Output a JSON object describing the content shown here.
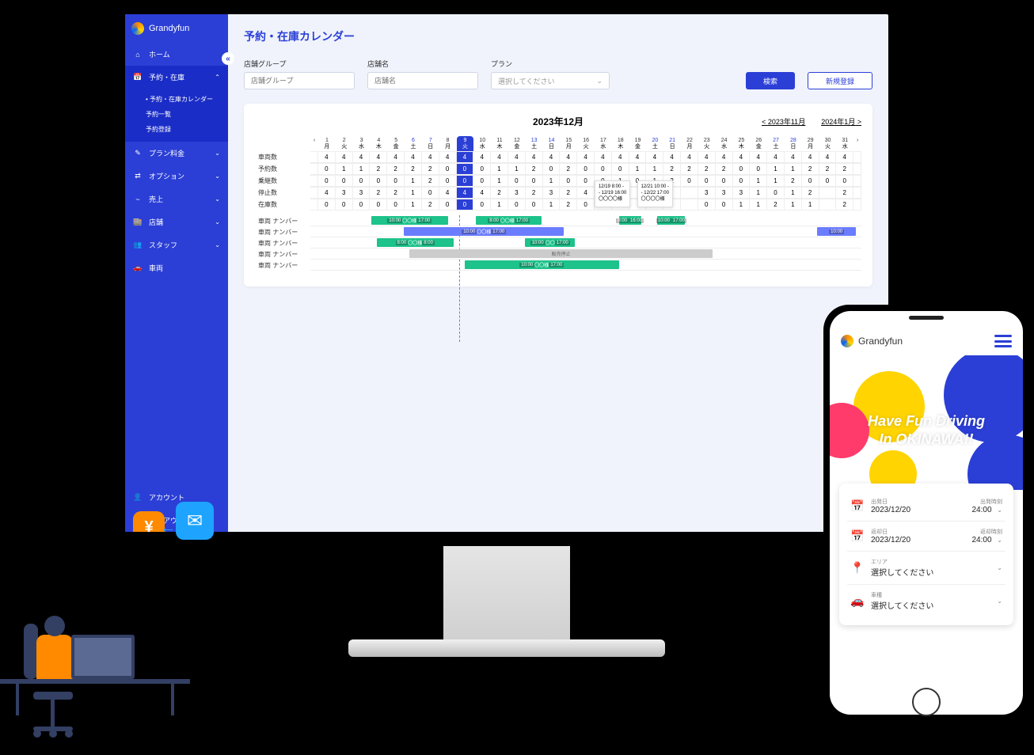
{
  "brand": "Grandyfun",
  "sidebar": {
    "items": [
      {
        "icon": "⌂",
        "label": "ホーム"
      },
      {
        "icon": "📅",
        "label": "予約・在庫",
        "chev": "⌃",
        "active": true
      },
      {
        "icon": "✎",
        "label": "プラン料金",
        "chev": "⌄"
      },
      {
        "icon": "⇄",
        "label": "オプション",
        "chev": "⌄"
      },
      {
        "icon": "~",
        "label": "売上",
        "chev": "⌄"
      },
      {
        "icon": "🏬",
        "label": "店舗",
        "chev": "⌄"
      },
      {
        "icon": "👥",
        "label": "スタッフ",
        "chev": "⌄"
      },
      {
        "icon": "🚗",
        "label": "車両"
      }
    ],
    "sub": [
      "予約・在庫カレンダー",
      "予約一覧",
      "予約登録"
    ],
    "bottom": [
      {
        "icon": "👤",
        "label": "アカウント"
      },
      {
        "icon": "↪",
        "label": "ログアウト"
      }
    ]
  },
  "page": {
    "title": "予約・在庫カレンダー",
    "filters": {
      "group_label": "店舗グループ",
      "group_ph": "店舗グループ",
      "store_label": "店舗名",
      "store_ph": "店舗名",
      "plan_label": "プラン",
      "plan_ph": "選択してください"
    },
    "search": "検索",
    "register": "新規登録"
  },
  "cal": {
    "title": "2023年12月",
    "prev": "2023年11月",
    "next": "2024年1月",
    "days": [
      {
        "n": "1",
        "w": "月"
      },
      {
        "n": "2",
        "w": "火"
      },
      {
        "n": "3",
        "w": "水"
      },
      {
        "n": "4",
        "w": "木"
      },
      {
        "n": "5",
        "w": "金"
      },
      {
        "n": "6",
        "w": "土",
        "c": "sat"
      },
      {
        "n": "7",
        "w": "日",
        "c": "sun"
      },
      {
        "n": "8",
        "w": "月"
      },
      {
        "n": "9",
        "w": "火",
        "c": "today"
      },
      {
        "n": "10",
        "w": "水"
      },
      {
        "n": "11",
        "w": "木"
      },
      {
        "n": "12",
        "w": "金"
      },
      {
        "n": "13",
        "w": "土",
        "c": "sat"
      },
      {
        "n": "14",
        "w": "日",
        "c": "sun"
      },
      {
        "n": "15",
        "w": "月"
      },
      {
        "n": "16",
        "w": "火"
      },
      {
        "n": "17",
        "w": "水"
      },
      {
        "n": "18",
        "w": "木"
      },
      {
        "n": "19",
        "w": "金"
      },
      {
        "n": "20",
        "w": "土",
        "c": "sat"
      },
      {
        "n": "21",
        "w": "日",
        "c": "sun"
      },
      {
        "n": "22",
        "w": "月"
      },
      {
        "n": "23",
        "w": "火"
      },
      {
        "n": "24",
        "w": "水"
      },
      {
        "n": "25",
        "w": "木"
      },
      {
        "n": "26",
        "w": "金"
      },
      {
        "n": "27",
        "w": "土",
        "c": "sat"
      },
      {
        "n": "28",
        "w": "日",
        "c": "sun"
      },
      {
        "n": "29",
        "w": "月"
      },
      {
        "n": "30",
        "w": "火"
      },
      {
        "n": "31",
        "w": "水"
      }
    ],
    "rows": [
      {
        "label": "車両数",
        "v": [
          "4",
          "4",
          "4",
          "4",
          "4",
          "4",
          "4",
          "4",
          "4",
          "4",
          "4",
          "4",
          "4",
          "4",
          "4",
          "4",
          "4",
          "4",
          "4",
          "4",
          "4",
          "4",
          "4",
          "4",
          "4",
          "4",
          "4",
          "4",
          "4",
          "4",
          "4"
        ]
      },
      {
        "label": "予約数",
        "v": [
          "0",
          "1",
          "1",
          "2",
          "2",
          "2",
          "2",
          "0",
          "0",
          "0",
          "1",
          "1",
          "2",
          "0",
          "2",
          "0",
          "0",
          "0",
          "1",
          "1",
          "2",
          "2",
          "2",
          "2",
          "0",
          "0",
          "1",
          "1",
          "2",
          "2",
          "2"
        ]
      },
      {
        "label": "乗継数",
        "v": [
          "0",
          "0",
          "0",
          "0",
          "0",
          "1",
          "2",
          "0",
          "0",
          "0",
          "1",
          "0",
          "0",
          "1",
          "0",
          "0",
          "0",
          "1",
          "0",
          "1",
          "2",
          "0",
          "0",
          "0",
          "0",
          "1",
          "1",
          "2",
          "0",
          "0",
          "0"
        ]
      },
      {
        "label": "停止数",
        "v": [
          "4",
          "3",
          "3",
          "2",
          "2",
          "1",
          "0",
          "4",
          "4",
          "4",
          "2",
          "3",
          "2",
          "3",
          "2",
          "4",
          "4",
          "3",
          "",
          "",
          "",
          "",
          "3",
          "3",
          "3",
          "1",
          "0",
          "1",
          "2",
          "",
          "2"
        ]
      },
      {
        "label": "在庫数",
        "v": [
          "0",
          "0",
          "0",
          "0",
          "0",
          "1",
          "2",
          "0",
          "0",
          "0",
          "1",
          "0",
          "0",
          "1",
          "2",
          "0",
          "0",
          "1",
          "",
          "",
          "",
          "",
          "0",
          "0",
          "1",
          "1",
          "2",
          "1",
          "1",
          "",
          "2"
        ]
      }
    ],
    "tooltip": {
      "l1": "12/19 8:00 -",
      "l2": "- 12/19 16:00",
      "l3": "〇〇〇〇様",
      "l4": "12/21 10:00 -",
      "l5": "- 12/22 17:00",
      "l6": "〇〇〇〇様"
    },
    "gantt_label": "車両 ナンバー",
    "bars": {
      "g1": {
        "t1": "10:00",
        "txt": "〇〇様",
        "t2": "17:00"
      },
      "g2": {
        "t1": "8:00",
        "txt": "〇〇様",
        "t2": "17:00"
      },
      "g3": {
        "t1": "8:00",
        "t2": "16:00"
      },
      "g4": {
        "t1": "10:00",
        "t2": "17:00"
      },
      "b1": {
        "t1": "10:00",
        "txt": "〇〇様",
        "t2": "17:00"
      },
      "b2": {
        "t1": "10:00"
      },
      "g5": {
        "t1": "8:00",
        "txt": "〇〇様",
        "t2": "8:00"
      },
      "g6": {
        "t1": "10:00",
        "txt": "〇〇",
        "t2": "17:00"
      },
      "gray": {
        "txt": "販売停止"
      },
      "g7": {
        "t1": "10:00",
        "txt": "〇〇様",
        "t2": "17:00"
      }
    }
  },
  "phone": {
    "brand": "Grandyfun",
    "hero1": "Have Fun Driving",
    "hero2": "In OKINAWA!!",
    "rows": [
      {
        "icon": "📅",
        "lbl": "出発日",
        "val": "2023/12/20",
        "tlbl": "出発時刻",
        "tval": "24:00"
      },
      {
        "icon": "📅",
        "lbl": "返却日",
        "val": "2023/12/20",
        "tlbl": "返却時刻",
        "tval": "24:00"
      },
      {
        "icon": "📍",
        "lbl": "エリア",
        "val": "選択してください"
      },
      {
        "icon": "🚗",
        "lbl": "車種",
        "val": "選択してください"
      }
    ]
  },
  "yen": "¥"
}
